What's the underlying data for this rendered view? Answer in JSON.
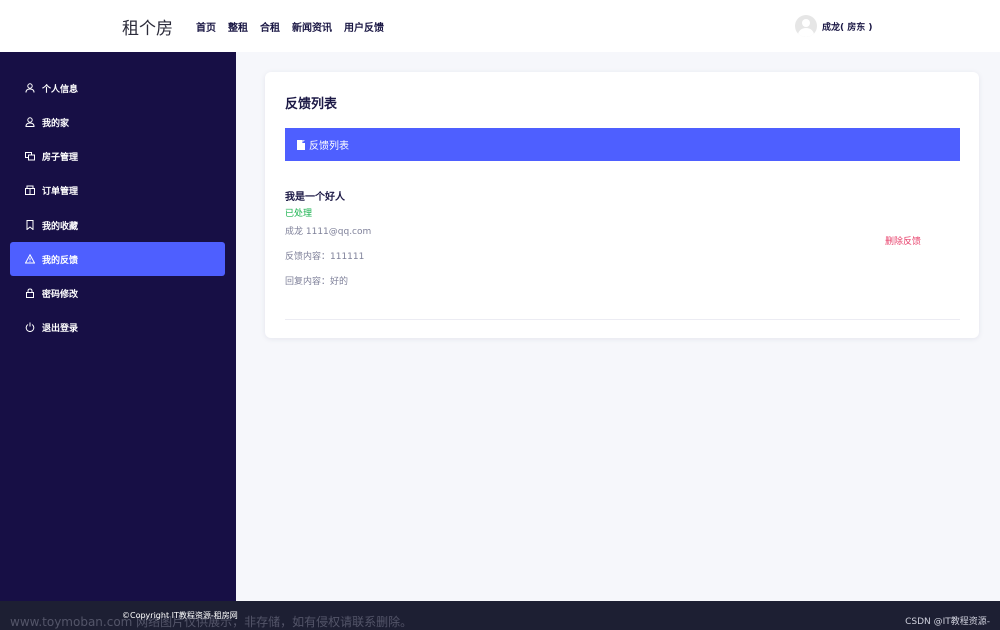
{
  "header": {
    "brand": "租个房",
    "nav": [
      "首页",
      "整租",
      "合租",
      "新闻资讯",
      "用户反馈"
    ],
    "user_name": "成龙( 房东 )"
  },
  "sidebar": {
    "items": [
      {
        "label": "个人信息",
        "icon": "user-icon",
        "active": false
      },
      {
        "label": "我的家",
        "icon": "home-user-icon",
        "active": false
      },
      {
        "label": "房子管理",
        "icon": "house-manage-icon",
        "active": false
      },
      {
        "label": "订单管理",
        "icon": "order-icon",
        "active": false
      },
      {
        "label": "我的收藏",
        "icon": "bookmark-icon",
        "active": false
      },
      {
        "label": "我的反馈",
        "icon": "warning-icon",
        "active": true
      },
      {
        "label": "密码修改",
        "icon": "lock-icon",
        "active": false
      },
      {
        "label": "退出登录",
        "icon": "power-icon",
        "active": false
      }
    ]
  },
  "main": {
    "title": "反馈列表",
    "list_bar_label": "反馈列表",
    "feedback": {
      "title": "我是一个好人",
      "status": "已处理",
      "user": "成龙 1111@qq.com",
      "content": "反馈内容：111111",
      "reply": "回复内容：好的",
      "delete_label": "删除反馈"
    }
  },
  "footer": {
    "copyright": "©Copyright IT教程资源-租房网",
    "watermark": "www.toymoban.com 网络图片仅供展示，非存储，如有侵权请联系删除。",
    "csdn": "CSDN @IT教程资源-"
  },
  "colors": {
    "accent": "#4e5fff",
    "sidebar_bg": "#170f45",
    "status_ok": "#17b14d",
    "danger": "#e8406b"
  }
}
